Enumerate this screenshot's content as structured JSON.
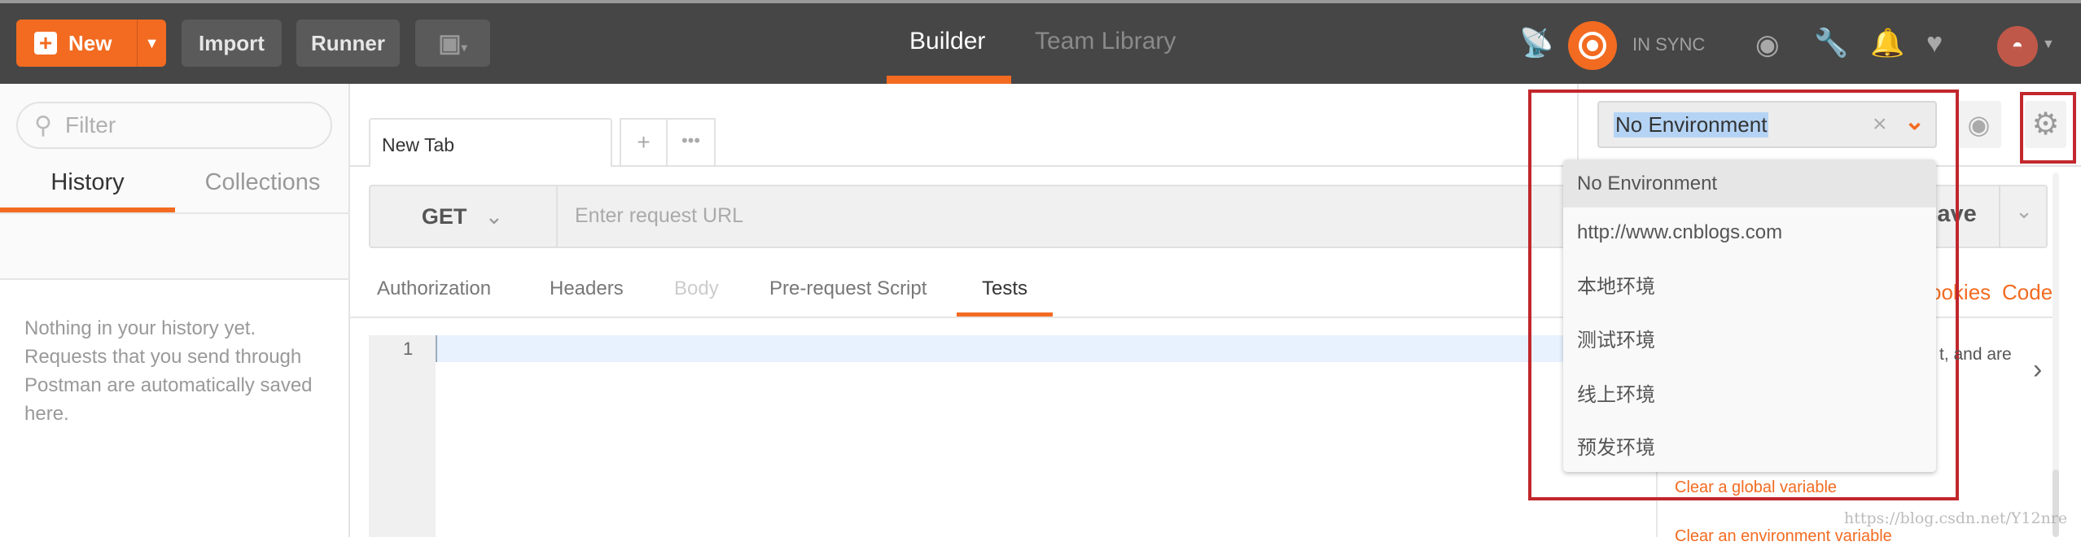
{
  "topbar": {
    "new_label": "New",
    "import_label": "Import",
    "runner_label": "Runner",
    "nav": [
      {
        "label": "Builder",
        "active": true
      },
      {
        "label": "Team Library",
        "active": false
      }
    ],
    "sync_status": "IN SYNC",
    "accent": "#f26b21"
  },
  "sidebar": {
    "filter_placeholder": "Filter",
    "tabs": [
      {
        "label": "History",
        "active": true
      },
      {
        "label": "Collections",
        "active": false
      }
    ],
    "empty_lines": [
      "Nothing in your history yet.",
      "Requests that you send through",
      "Postman are automatically saved",
      "here."
    ]
  },
  "request": {
    "tab_label": "New Tab",
    "method": "GET",
    "url_placeholder": "Enter request URL",
    "save_label": "Save",
    "subtabs": [
      {
        "label": "Authorization"
      },
      {
        "label": "Headers"
      },
      {
        "label": "Body",
        "disabled": true
      },
      {
        "label": "Pre-request Script"
      },
      {
        "label": "Tests",
        "active": true
      }
    ],
    "line_number": "1"
  },
  "right_panel": {
    "cookies_label": "ookies",
    "code_label": "Code",
    "snippet_fragment": "t, and are",
    "links": [
      "Clear a global variable",
      "Clear an environment variable"
    ]
  },
  "environment": {
    "selected": "No Environment",
    "options": [
      "No Environment",
      "http://www.cnblogs.com",
      "本地环境",
      "测试环境",
      "线上环境",
      "预发环境"
    ]
  },
  "watermark": "https://blog.csdn.net/Y12nre"
}
